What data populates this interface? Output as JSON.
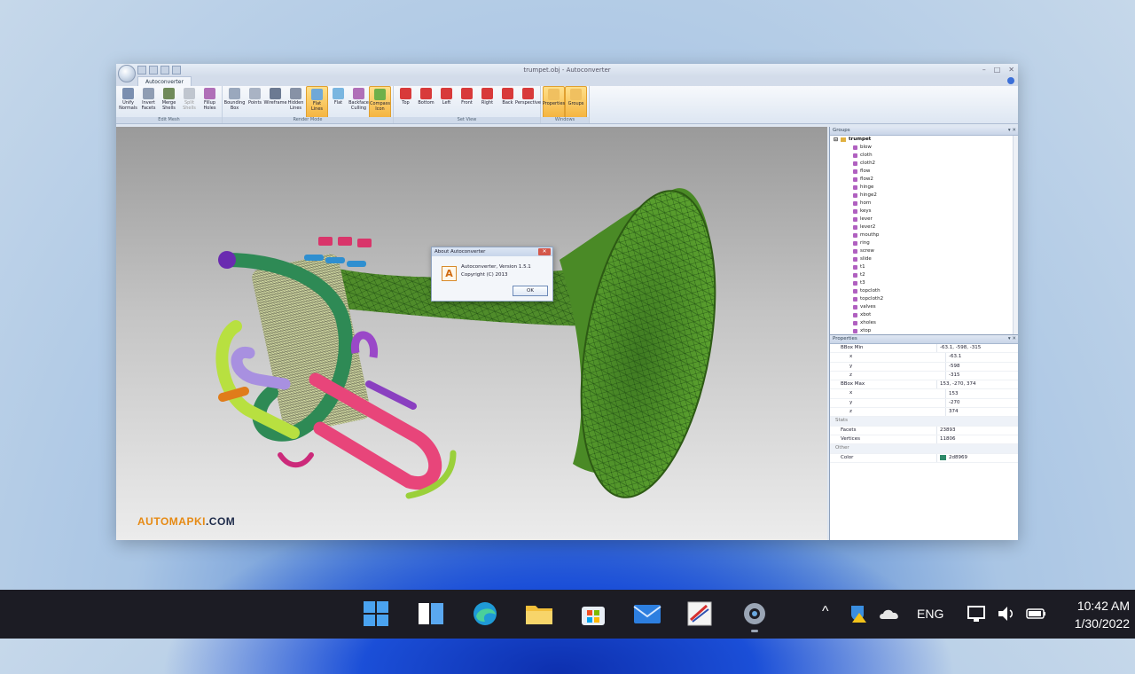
{
  "window": {
    "title": "trumpet.obj - Autoconverter",
    "tab": "Autoconverter",
    "controls": [
      "–",
      "□",
      "✕"
    ]
  },
  "ribbon": {
    "groups": [
      {
        "label": "Edit Mesh",
        "buttons": [
          {
            "label": "Unify Normals",
            "icon": "unify-normals-icon",
            "color": "#7a8fb0"
          },
          {
            "label": "Invert Facets",
            "icon": "invert-facets-icon",
            "color": "#8f9db3"
          },
          {
            "label": "Merge Shells",
            "icon": "merge-shells-icon",
            "color": "#6f8a5a"
          },
          {
            "label": "Split Shells",
            "icon": "split-shells-icon",
            "color": "#c0c6cf",
            "disabled": true
          },
          {
            "label": "Fillup Holes",
            "icon": "fillup-holes-icon",
            "color": "#b06fb8"
          }
        ]
      },
      {
        "label": "Render Mode",
        "buttons": [
          {
            "label": "Bounding Box",
            "icon": "bounding-box-icon",
            "color": "#9aa8bd"
          },
          {
            "label": "Points",
            "icon": "points-icon",
            "color": "#a9b3c4"
          },
          {
            "label": "Wireframe",
            "icon": "wireframe-icon",
            "color": "#6c7a92"
          },
          {
            "label": "Hidden Lines",
            "icon": "hidden-lines-icon",
            "color": "#8792a6"
          },
          {
            "label": "Flat Lines",
            "icon": "flat-lines-icon",
            "color": "#6fa8d8",
            "active": true
          },
          {
            "label": "Flat",
            "icon": "flat-icon",
            "color": "#7ab6e0"
          },
          {
            "label": "Backface Culling",
            "icon": "backface-culling-icon",
            "color": "#b06fb8"
          },
          {
            "label": "Compass Icon",
            "icon": "compass-icon",
            "color": "#6fb04a",
            "active": true
          }
        ]
      },
      {
        "label": "Set View",
        "buttons": [
          {
            "label": "Top",
            "icon": "top-view-icon",
            "color": "#d83a3a"
          },
          {
            "label": "Bottom",
            "icon": "bottom-view-icon",
            "color": "#d83a3a"
          },
          {
            "label": "Left",
            "icon": "left-view-icon",
            "color": "#d83a3a"
          },
          {
            "label": "Front",
            "icon": "front-view-icon",
            "color": "#d83a3a"
          },
          {
            "label": "Right",
            "icon": "right-view-icon",
            "color": "#d83a3a"
          },
          {
            "label": "Back",
            "icon": "back-view-icon",
            "color": "#d83a3a"
          },
          {
            "label": "Perspective",
            "icon": "perspective-icon",
            "color": "#d83a3a"
          }
        ]
      },
      {
        "label": "Windows",
        "buttons": [
          {
            "label": "Properties",
            "icon": "properties-icon",
            "color": "#f0c060",
            "active": true
          },
          {
            "label": "Groups",
            "icon": "groups-icon",
            "color": "#f0c060",
            "active": true
          }
        ]
      }
    ]
  },
  "viewport": {
    "watermark_a": "AUTOMAPKI",
    "watermark_b": ".COM"
  },
  "dialog": {
    "title": "About Autoconverter",
    "close": "✕",
    "icon_letter": "A",
    "line1": "Autoconverter, Version 1.5.1",
    "line2": "Copyright (C) 2013",
    "ok": "OK"
  },
  "groups_panel": {
    "title": "Groups",
    "controls": "▾ ✕",
    "root": "trumpet",
    "items": [
      "blow",
      "cloth",
      "cloth2",
      "flow",
      "flow2",
      "hinge",
      "hinge2",
      "horn",
      "keys",
      "lever",
      "lever2",
      "mouthp",
      "ring",
      "screw",
      "slide",
      "t1",
      "t2",
      "t3",
      "topcloth",
      "topcloth2",
      "valves",
      "xbot",
      "xholes",
      "xtop"
    ]
  },
  "properties_panel": {
    "title": "Properties",
    "controls": "▾ ✕",
    "rows": [
      {
        "key": "BBox Min",
        "value": "-63.1, -598, -315",
        "type": "group"
      },
      {
        "key": "x",
        "value": "-63.1",
        "type": "sub"
      },
      {
        "key": "y",
        "value": "-598",
        "type": "sub"
      },
      {
        "key": "z",
        "value": "-315",
        "type": "sub"
      },
      {
        "key": "BBox Max",
        "value": "153, -270, 374",
        "type": "group"
      },
      {
        "key": "x",
        "value": "153",
        "type": "sub"
      },
      {
        "key": "y",
        "value": "-270",
        "type": "sub"
      },
      {
        "key": "z",
        "value": "374",
        "type": "sub"
      },
      {
        "key": "Stats",
        "value": "",
        "type": "section"
      },
      {
        "key": "Facets",
        "value": "23893",
        "type": "plain"
      },
      {
        "key": "Vertices",
        "value": "11806",
        "type": "plain"
      },
      {
        "key": "Other",
        "value": "",
        "type": "section"
      },
      {
        "key": "Color",
        "value": "2d8969",
        "type": "color",
        "swatch": "#2d8969"
      }
    ]
  },
  "taskbar": {
    "icons": [
      "windows-start-icon",
      "task-view-icon",
      "edge-icon",
      "file-explorer-icon",
      "store-icon",
      "mail-icon",
      "autoconverter-icon",
      "settings-icon"
    ],
    "tray_language": "ENG",
    "clock_time": "10:42 AM",
    "clock_date": "1/30/2022"
  }
}
